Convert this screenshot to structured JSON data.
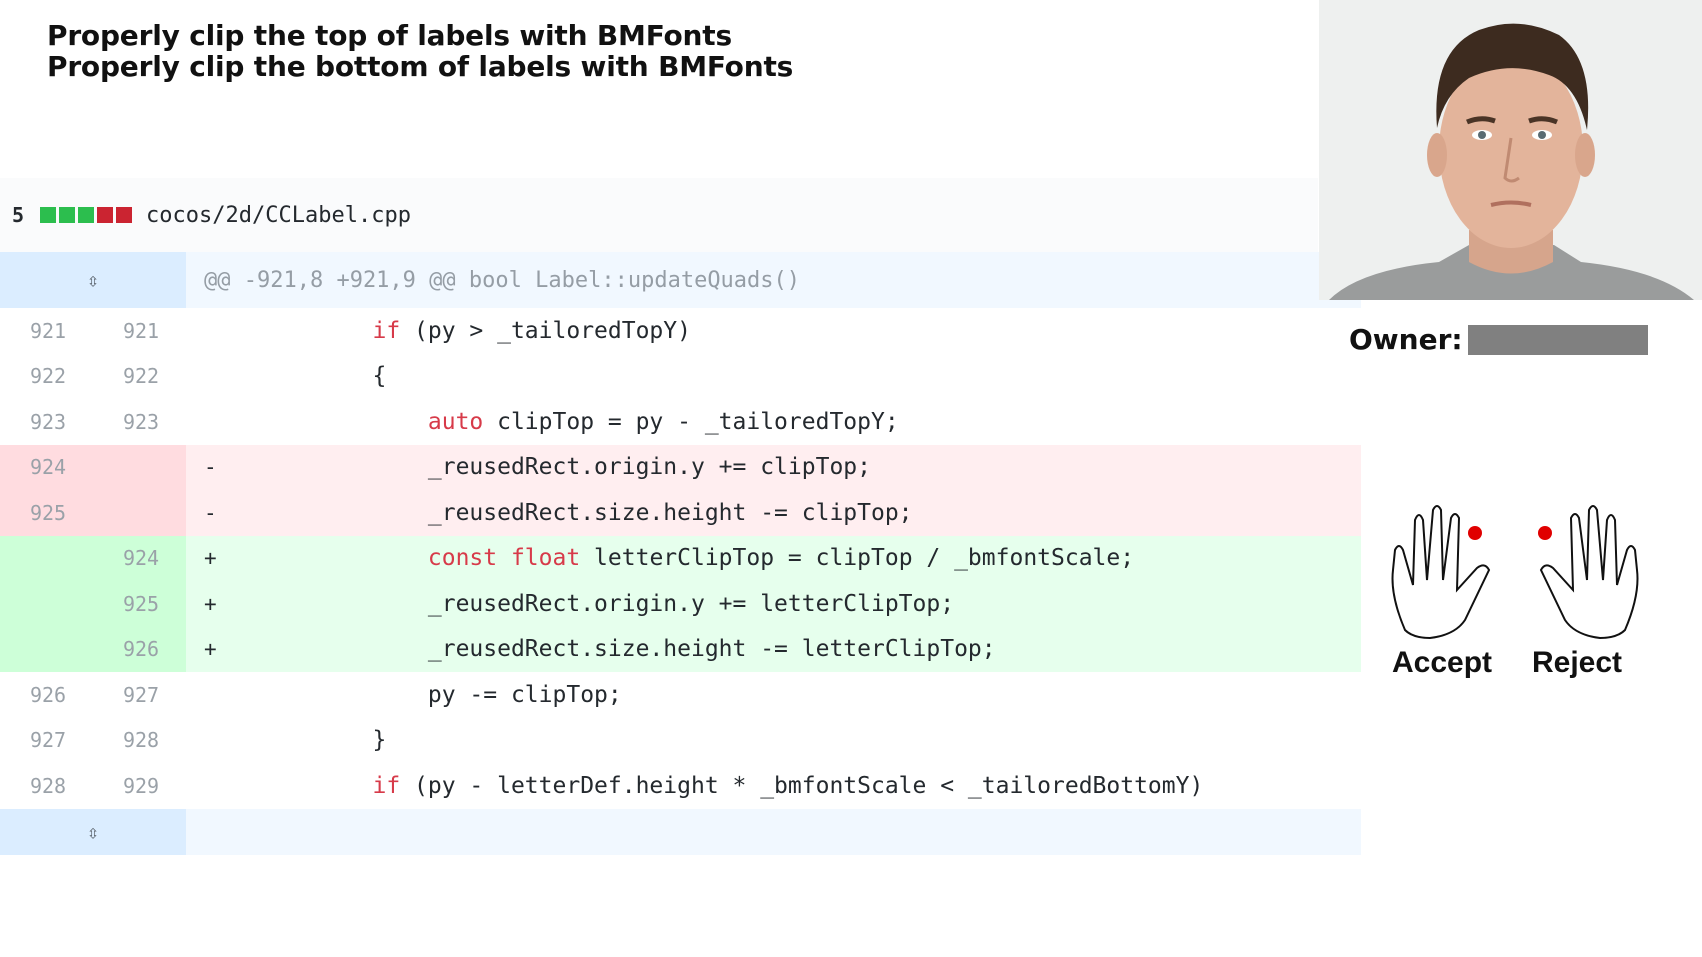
{
  "titles": {
    "line1": "Properly clip the top of labels with BMFonts",
    "line2": "Properly clip the bottom of labels with BMFonts"
  },
  "file": {
    "change_count": "5",
    "diffstat": [
      "add",
      "add",
      "add",
      "del",
      "del"
    ],
    "path": "cocos/2d/CCLabel.cpp"
  },
  "hunk": {
    "header": "@@ -921,8 +921,9 @@ bool Label::updateQuads()",
    "expand_icon": "unfold-icon"
  },
  "diff_lines": [
    {
      "type": "ctx",
      "old": "921",
      "new": "921",
      "marker": "",
      "indent": "          ",
      "kw": "if",
      "rest": " (py > _tailoredTopY)"
    },
    {
      "type": "ctx",
      "old": "922",
      "new": "922",
      "marker": "",
      "indent": "          ",
      "kw": "",
      "rest": "{"
    },
    {
      "type": "ctx",
      "old": "923",
      "new": "923",
      "marker": "",
      "indent": "              ",
      "kw": "auto",
      "rest": " clipTop = py - _tailoredTopY;"
    },
    {
      "type": "del",
      "old": "924",
      "new": "",
      "marker": "-",
      "indent": "              ",
      "kw": "",
      "rest": "_reusedRect.origin.y += clipTop;"
    },
    {
      "type": "del",
      "old": "925",
      "new": "",
      "marker": "-",
      "indent": "              ",
      "kw": "",
      "rest": "_reusedRect.size.height -= clipTop;"
    },
    {
      "type": "add",
      "old": "",
      "new": "924",
      "marker": "+",
      "indent": "              ",
      "kw": "const float",
      "rest": " letterClipTop = clipTop / _bmfontScale;"
    },
    {
      "type": "add",
      "old": "",
      "new": "925",
      "marker": "+",
      "indent": "              ",
      "kw": "",
      "rest": "_reusedRect.origin.y += letterClipTop;"
    },
    {
      "type": "add",
      "old": "",
      "new": "926",
      "marker": "+",
      "indent": "              ",
      "kw": "",
      "rest": "_reusedRect.size.height -= letterClipTop;"
    },
    {
      "type": "ctx",
      "old": "926",
      "new": "927",
      "marker": "",
      "indent": "              ",
      "kw": "",
      "rest": "py -= clipTop;"
    },
    {
      "type": "ctx",
      "old": "927",
      "new": "928",
      "marker": "",
      "indent": "          ",
      "kw": "",
      "rest": "}"
    },
    {
      "type": "ctx",
      "old": "928",
      "new": "929",
      "marker": "",
      "indent": "          ",
      "kw": "if",
      "rest": " (py - letterDef.height * _bmfontScale < _tailoredBottomY)"
    }
  ],
  "sidebar": {
    "owner_label": "Owner:",
    "accept_label": "Accept",
    "reject_label": "Reject",
    "accept_icon": "left-hand-icon",
    "reject_icon": "right-hand-icon",
    "face_image": "person-portrait"
  },
  "colors": {
    "add_bg": "#e6ffed",
    "del_bg": "#ffeef0",
    "keyword": "#d73a49",
    "marker_dot": "#e00000",
    "owner_bar": "#808080"
  }
}
